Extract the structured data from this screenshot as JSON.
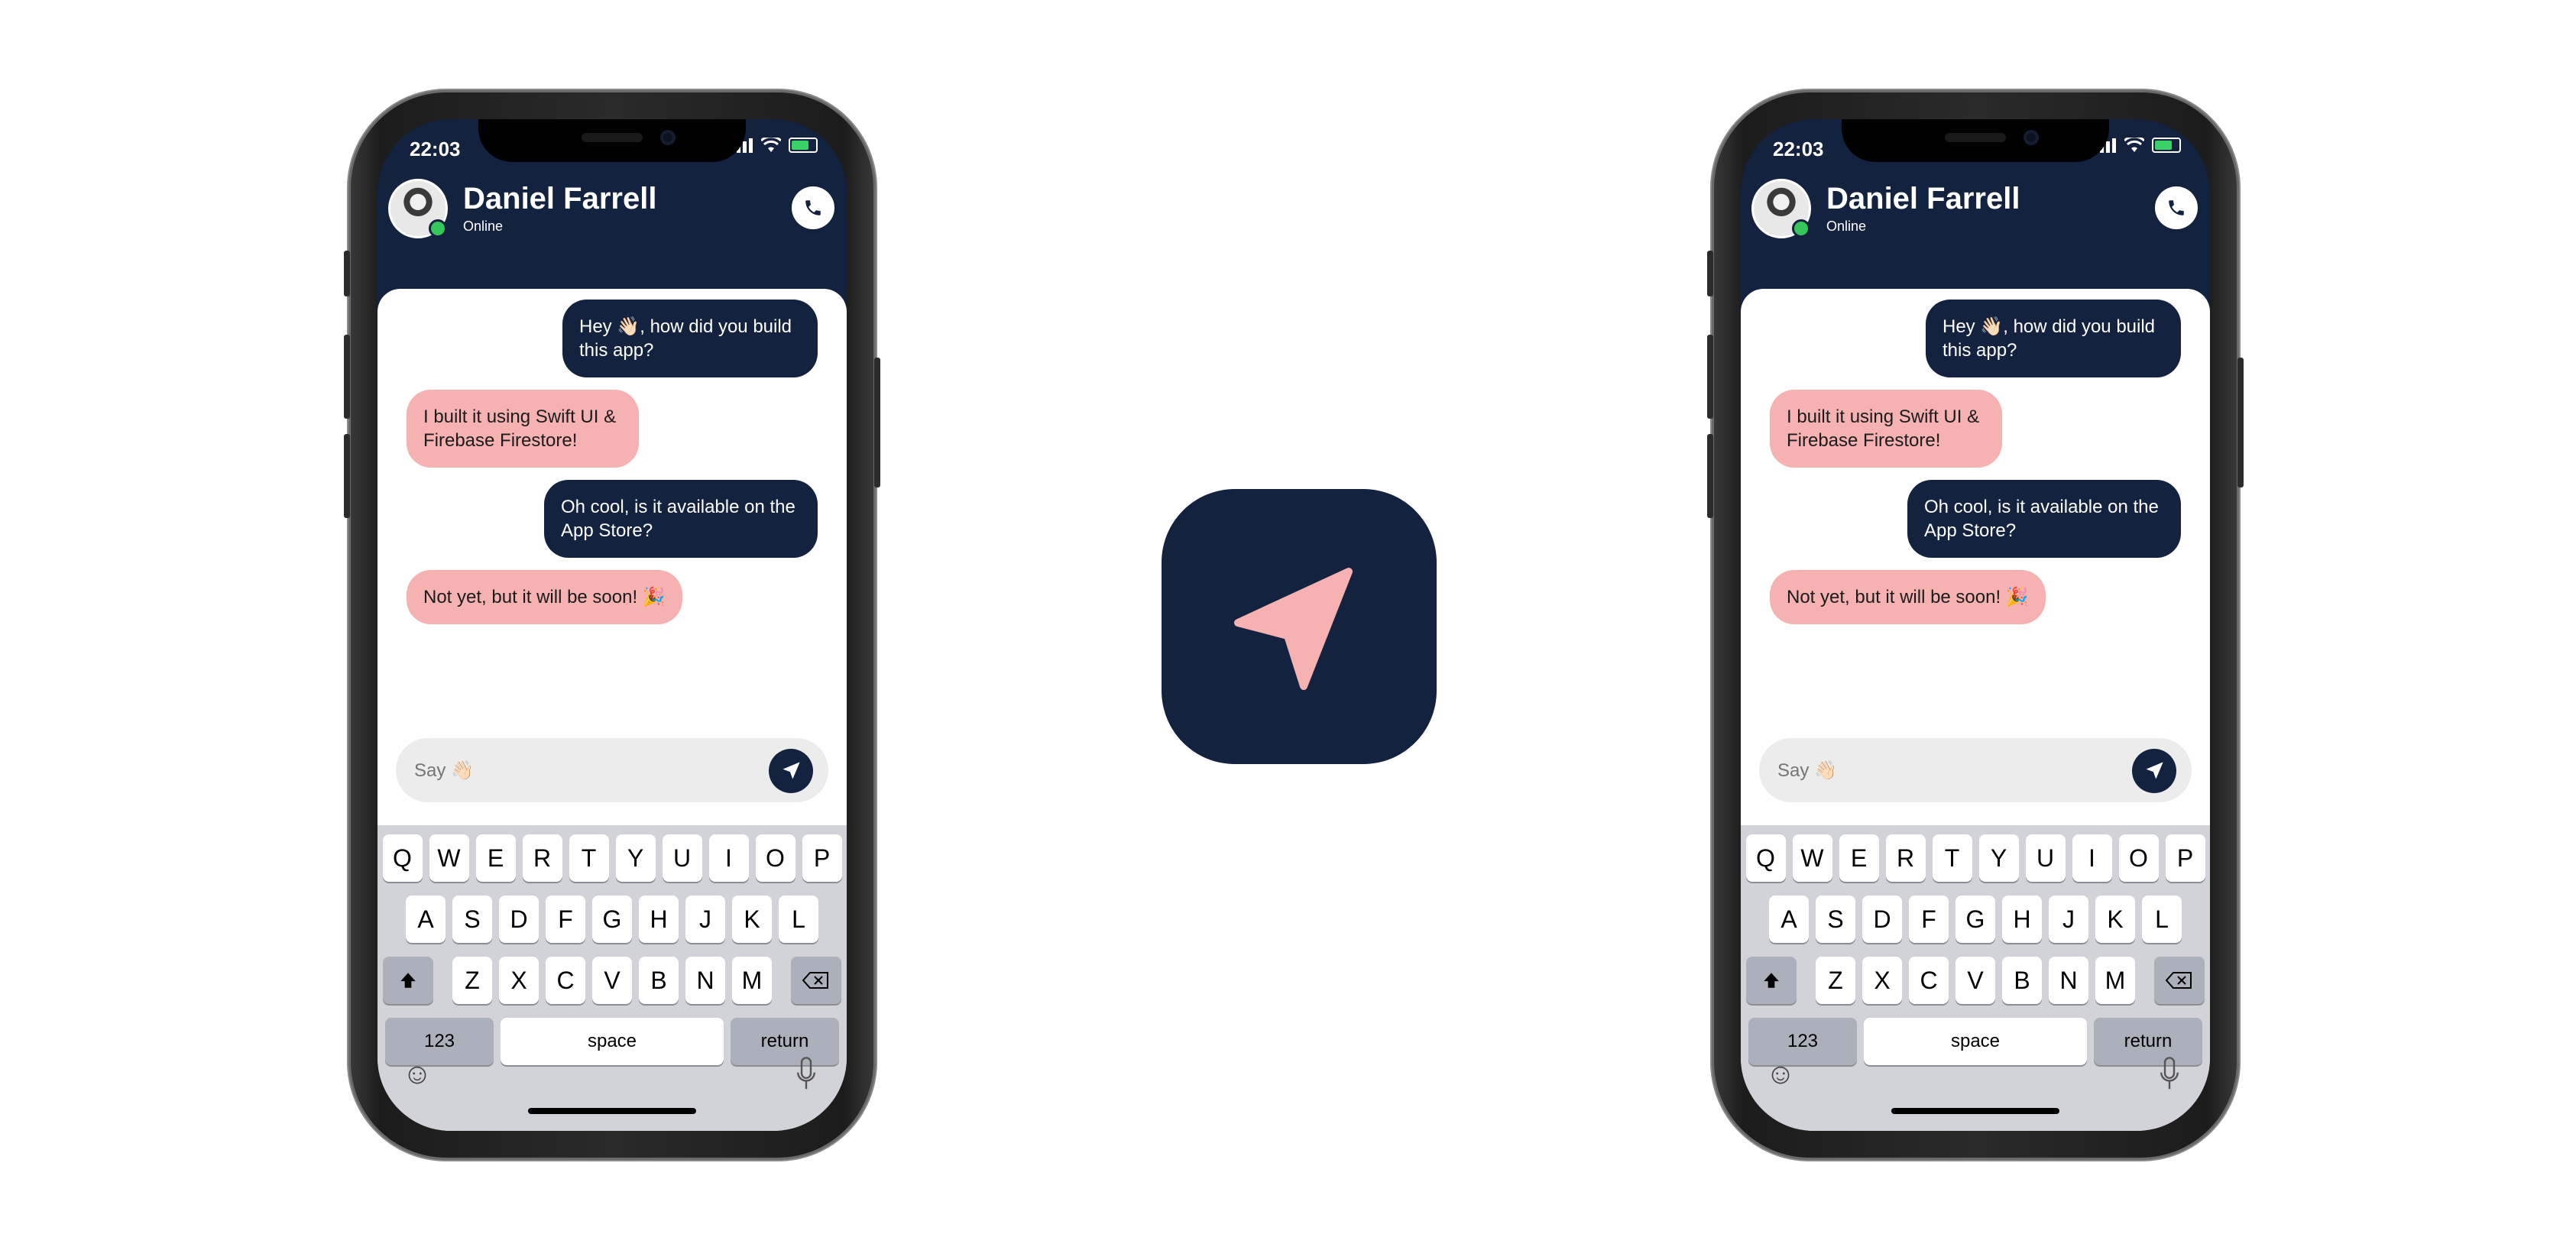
{
  "colors": {
    "navy": "#12223f",
    "bubble_in": "#f6b1b1",
    "online": "#35c759",
    "composer": "#ececec",
    "keyboard": "#d1d3d9"
  },
  "app_icon": {
    "icon": "paper-plane-icon"
  },
  "phones": [
    {
      "status": {
        "time": "22:03"
      },
      "contact": {
        "name": "Daniel Farrell",
        "presence": "Online"
      },
      "messages": [
        {
          "from": "me",
          "text": "Hey 👋🏻, how did you build this app?"
        },
        {
          "from": "them",
          "text": "I built it using Swift UI & Firebase Firestore!"
        },
        {
          "from": "me",
          "text": "Oh cool, is it available on the App Store?"
        },
        {
          "from": "them",
          "text": "Not yet, but it will be soon! 🎉"
        }
      ],
      "composer": {
        "placeholder": "Say 👋🏻"
      },
      "keyboard": {
        "row1": [
          "Q",
          "W",
          "E",
          "R",
          "T",
          "Y",
          "U",
          "I",
          "O",
          "P"
        ],
        "row2": [
          "A",
          "S",
          "D",
          "F",
          "G",
          "H",
          "J",
          "K",
          "L"
        ],
        "row3": [
          "Z",
          "X",
          "C",
          "V",
          "B",
          "N",
          "M"
        ],
        "numbers": "123",
        "space": "space",
        "return": "return"
      }
    },
    {
      "status": {
        "time": "22:03"
      },
      "contact": {
        "name": "Daniel Farrell",
        "presence": "Online"
      },
      "messages": [
        {
          "from": "me",
          "text": "Hey 👋🏻, how did you build this app?"
        },
        {
          "from": "them",
          "text": "I built it using Swift UI & Firebase Firestore!"
        },
        {
          "from": "me",
          "text": "Oh cool, is it available on the App Store?"
        },
        {
          "from": "them",
          "text": "Not yet, but it will be soon! 🎉"
        }
      ],
      "composer": {
        "placeholder": "Say 👋🏻"
      },
      "keyboard": {
        "row1": [
          "Q",
          "W",
          "E",
          "R",
          "T",
          "Y",
          "U",
          "I",
          "O",
          "P"
        ],
        "row2": [
          "A",
          "S",
          "D",
          "F",
          "G",
          "H",
          "J",
          "K",
          "L"
        ],
        "row3": [
          "Z",
          "X",
          "C",
          "V",
          "B",
          "N",
          "M"
        ],
        "numbers": "123",
        "space": "space",
        "return": "return"
      }
    }
  ]
}
